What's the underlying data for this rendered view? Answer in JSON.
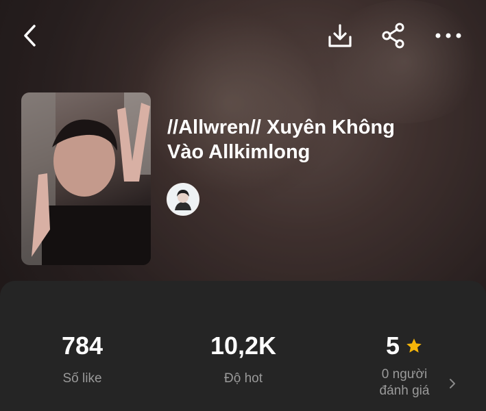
{
  "header": {
    "back_icon": "chevron-left-icon",
    "download_icon": "download-icon",
    "share_icon": "share-icon",
    "more_icon": "more-horizontal-icon"
  },
  "story": {
    "title_line1": "//Allwren// Xuyên Không",
    "title_line2": "Vào Allkimlong"
  },
  "stats": {
    "likes": {
      "value": "784",
      "label": "Số like"
    },
    "hot": {
      "value": "10,2K",
      "label": "Độ hot"
    },
    "rating": {
      "value": "5",
      "label_line1": "0 người",
      "label_line2": "đánh giá",
      "star_icon": "star-icon"
    }
  },
  "colors": {
    "panel": "#252525",
    "text_primary": "#ffffff",
    "text_secondary": "#9a9a9a",
    "star": "#f5b50a"
  }
}
